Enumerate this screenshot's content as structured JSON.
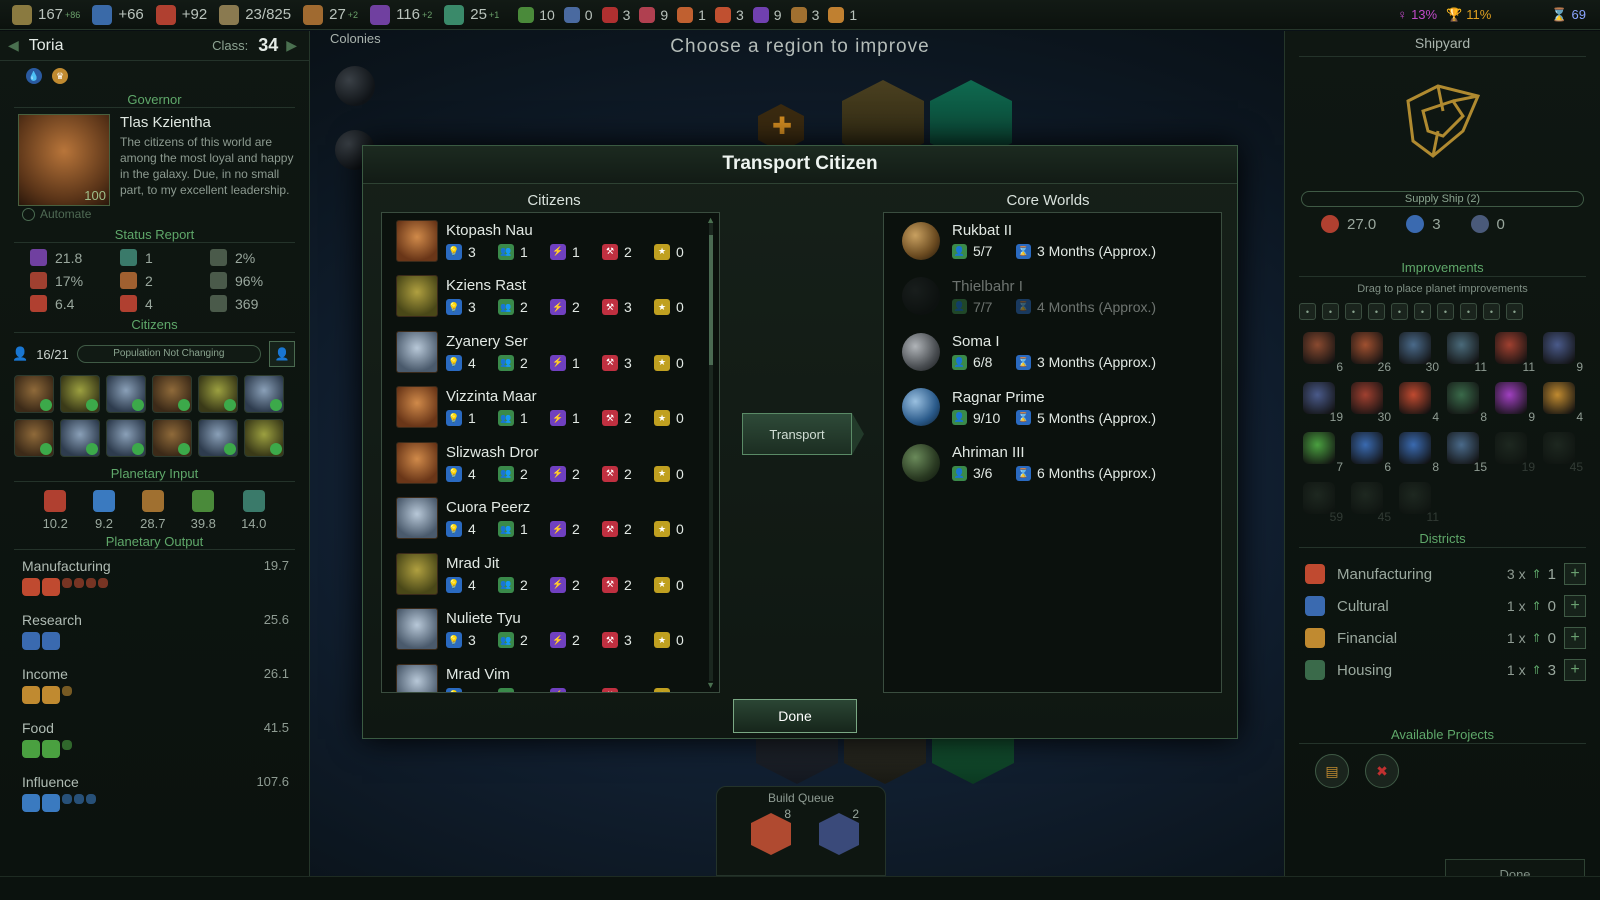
{
  "topbar": {
    "resources": [
      {
        "icon": "credits-icon",
        "value": "167",
        "delta": "+86",
        "color": "#8a7a40"
      },
      {
        "icon": "research-flask-icon",
        "value": "+66",
        "delta": "",
        "color": "#3a6aa8"
      },
      {
        "icon": "manufacturing-hammer-icon",
        "value": "+92",
        "delta": "",
        "color": "#b04030"
      },
      {
        "icon": "population-box-icon",
        "value": "23/825",
        "delta": "",
        "color": "#8a7a50"
      },
      {
        "icon": "approval-icon",
        "value": "27",
        "delta": "+2",
        "color": "#a06a30"
      },
      {
        "icon": "influence-icon",
        "value": "116",
        "delta": "+2",
        "color": "#7040a0"
      },
      {
        "icon": "fleet-icon",
        "value": "25",
        "delta": "+1",
        "color": "#3a8a6a"
      }
    ],
    "strategic": [
      {
        "icon": "food-apple-icon",
        "value": "10",
        "color": "#4a8a3a"
      },
      {
        "icon": "crystal-icon",
        "value": "0",
        "color": "#4a6aa0"
      },
      {
        "icon": "antimatter-icon",
        "value": "3",
        "color": "#b03030"
      },
      {
        "icon": "durantium-icon",
        "value": "9",
        "color": "#b04050"
      },
      {
        "icon": "elerium-icon",
        "value": "1",
        "color": "#c06030"
      },
      {
        "icon": "promethion-icon",
        "value": "3",
        "color": "#c05030"
      },
      {
        "icon": "thulium-icon",
        "value": "9",
        "color": "#7040b0"
      },
      {
        "icon": "relic-icon",
        "value": "3",
        "color": "#a07030"
      },
      {
        "icon": "artifact-icon",
        "value": "1",
        "color": "#c08030"
      }
    ],
    "victory": [
      {
        "icon": "influence-victory-icon",
        "value": "13%"
      },
      {
        "icon": "trophy-icon",
        "value": "11%"
      },
      {
        "icon": "turn-icon",
        "value": "69"
      }
    ]
  },
  "left": {
    "planet_name": "Toria",
    "class_label": "Class:",
    "class_value": "34",
    "governor_section": "Governor",
    "governor_name": "Tlas Kzientha",
    "governor_desc": "The citizens of this world are among the most loyal and happy in the galaxy. Due, in no small part, to my excellent leadership.",
    "governor_level": "100",
    "automate": "Automate",
    "status_section": "Status Report",
    "status": [
      {
        "icon": "influence-icon",
        "value": "21.8",
        "color": "#7040a0"
      },
      {
        "icon": "building-icon",
        "value": "1",
        "color": "#3a7a6a"
      },
      {
        "icon": "hazard-icon",
        "value": "2%",
        "color": "#4a5a4a"
      },
      {
        "icon": "population-icon",
        "value": "17%",
        "color": "#a04030"
      },
      {
        "icon": "tax-icon",
        "value": "2",
        "color": "#a06030"
      },
      {
        "icon": "approval-face-icon",
        "value": "96%",
        "color": "#4a5a4a"
      },
      {
        "icon": "manufacturing-hammer-icon",
        "value": "6.4",
        "color": "#b04030"
      },
      {
        "icon": "wrench-icon",
        "value": "4",
        "color": "#b04030"
      },
      {
        "icon": "defense-shield-icon",
        "value": "369",
        "color": "#4a5a4a"
      }
    ],
    "citizens_section": "Citizens",
    "population": "16/21",
    "population_status": "Population Not Changing",
    "input_section": "Planetary Input",
    "inputs": [
      {
        "icon": "production-gear-icon",
        "value": "10.2",
        "color": "#b04030"
      },
      {
        "icon": "research-bulb-icon",
        "value": "9.2",
        "color": "#3a7ac0"
      },
      {
        "icon": "money-icon",
        "value": "28.7",
        "color": "#a07030"
      },
      {
        "icon": "leaf-icon",
        "value": "39.8",
        "color": "#4a8a3a"
      },
      {
        "icon": "influence-building-icon",
        "value": "14.0",
        "color": "#3a7a6a"
      }
    ],
    "output_section": "Planetary Output",
    "outputs": [
      {
        "label": "Manufacturing",
        "value": "19.7",
        "color": "#c04a30",
        "count": 6
      },
      {
        "label": "Research",
        "value": "25.6",
        "color": "#3a6ab0",
        "count": 2
      },
      {
        "label": "Income",
        "value": "26.1",
        "color": "#c08a30",
        "count": 3
      },
      {
        "label": "Food",
        "value": "41.5",
        "color": "#4aa040",
        "count": 3
      },
      {
        "label": "Influence",
        "value": "107.6",
        "color": "#3a7ac0",
        "count": 5
      }
    ]
  },
  "center": {
    "colonies_label": "Colonies",
    "heading": "Choose a region to improve"
  },
  "modal": {
    "title": "Transport Citizen",
    "citizens_title": "Citizens",
    "worlds_title": "Core Worlds",
    "transport_label": "Transport",
    "done_label": "Done",
    "stat_icons": [
      "research-bulb-icon",
      "population-icon",
      "energy-icon",
      "manufacturing-icon",
      "star-icon"
    ],
    "citizens": [
      {
        "name": "Ktopash Nau",
        "face": "orange",
        "stats": [
          "3",
          "1",
          "1",
          "2",
          "0"
        ]
      },
      {
        "name": "Kziens Rast",
        "face": "green",
        "stats": [
          "3",
          "2",
          "2",
          "3",
          "0"
        ]
      },
      {
        "name": "Zyanery Ser",
        "face": "blue",
        "stats": [
          "4",
          "2",
          "1",
          "3",
          "0"
        ]
      },
      {
        "name": "Vizzinta Maar",
        "face": "orange",
        "stats": [
          "1",
          "1",
          "1",
          "2",
          "0"
        ]
      },
      {
        "name": "Slizwash Dror",
        "face": "orange",
        "stats": [
          "4",
          "2",
          "2",
          "2",
          "0"
        ]
      },
      {
        "name": "Cuora Peerz",
        "face": "blue",
        "stats": [
          "4",
          "1",
          "2",
          "2",
          "0"
        ]
      },
      {
        "name": "Mrad Jit",
        "face": "green",
        "stats": [
          "4",
          "2",
          "2",
          "2",
          "0"
        ]
      },
      {
        "name": "Nuliete Tyu",
        "face": "blue",
        "stats": [
          "3",
          "2",
          "2",
          "3",
          "0"
        ]
      },
      {
        "name": "Mrad Vim",
        "face": "blue",
        "stats": [
          "",
          "",
          "",
          "",
          ""
        ]
      }
    ],
    "worlds": [
      {
        "name": "Rukbat II",
        "pop": "5/7",
        "time": "3 Months (Approx.)",
        "planet": "desert",
        "dim": false
      },
      {
        "name": "Thielbahr I",
        "pop": "7/7",
        "time": "4 Months (Approx.)",
        "planet": "dark",
        "dim": true
      },
      {
        "name": "Soma I",
        "pop": "6/8",
        "time": "3 Months (Approx.)",
        "planet": "grey",
        "dim": false
      },
      {
        "name": "Ragnar Prime",
        "pop": "9/10",
        "time": "5 Months (Approx.)",
        "planet": "ocean",
        "dim": false
      },
      {
        "name": "Ahriman III",
        "pop": "3/6",
        "time": "6 Months (Approx.)",
        "planet": "jungle",
        "dim": false
      }
    ]
  },
  "right": {
    "shipyard_title": "Shipyard",
    "ship_name": "Supply Ship (2)",
    "ship_stats": [
      {
        "icon": "manufacturing-icon",
        "value": "27.0",
        "color": "#b04030"
      },
      {
        "icon": "moves-icon",
        "value": "3",
        "color": "#3a6ab0"
      },
      {
        "icon": "shield-icon",
        "value": "0",
        "color": "#4a5a7a"
      }
    ],
    "improvements_section": "Improvements",
    "drag_hint": "Drag to place planet improvements",
    "improvements": [
      {
        "n": "6",
        "color": "#8a4a30",
        "dim": false
      },
      {
        "n": "26",
        "color": "#a05030",
        "dim": false
      },
      {
        "n": "30",
        "color": "#4a6a8a",
        "dim": false
      },
      {
        "n": "11",
        "color": "#4a6a7a",
        "dim": false
      },
      {
        "n": "11",
        "color": "#a04030",
        "dim": false
      },
      {
        "n": "9",
        "color": "#4a5a8a",
        "dim": false
      },
      {
        "n": "19",
        "color": "#4a5a8a",
        "dim": false
      },
      {
        "n": "30",
        "color": "#a04030",
        "dim": false
      },
      {
        "n": "4",
        "color": "#c04a30",
        "dim": false
      },
      {
        "n": "8",
        "color": "#3a6a4a",
        "dim": false
      },
      {
        "n": "9",
        "color": "#a040c0",
        "dim": false
      },
      {
        "n": "4",
        "color": "#c08a30",
        "dim": false
      },
      {
        "n": "7",
        "color": "#4aa040",
        "dim": false
      },
      {
        "n": "6",
        "color": "#3a6ab0",
        "dim": false
      },
      {
        "n": "8",
        "color": "#3a6ab0",
        "dim": false
      },
      {
        "n": "15",
        "color": "#4a6a8a",
        "dim": false
      },
      {
        "n": "19",
        "color": "#4a5a4a",
        "dim": true
      },
      {
        "n": "45",
        "color": "#4a5a4a",
        "dim": true
      },
      {
        "n": "59",
        "color": "#4a5a4a",
        "dim": true
      },
      {
        "n": "45",
        "color": "#4a5a4a",
        "dim": true
      },
      {
        "n": "11",
        "color": "#4a5a4a",
        "dim": true
      }
    ],
    "districts_section": "Districts",
    "districts": [
      {
        "label": "Manufacturing",
        "count": "3 x",
        "level": "1",
        "icon": "manufacturing-hammer-icon",
        "color": "#c04a30"
      },
      {
        "label": "Cultural",
        "count": "1 x",
        "level": "0",
        "icon": "cultural-flag-icon",
        "color": "#3a6ab0"
      },
      {
        "label": "Financial",
        "count": "1 x",
        "level": "0",
        "icon": "financial-icon",
        "color": "#c08a30"
      },
      {
        "label": "Housing",
        "count": "1 x",
        "level": "3",
        "icon": "housing-icon",
        "color": "#3a6a4a"
      }
    ],
    "projects_section": "Available Projects",
    "done_label": "Done"
  },
  "build_queue": {
    "title": "Build Queue",
    "items": [
      {
        "n": "8",
        "icon": "manufacturing-hammer-icon"
      },
      {
        "n": "2",
        "icon": "supply-ship-icon"
      }
    ]
  }
}
